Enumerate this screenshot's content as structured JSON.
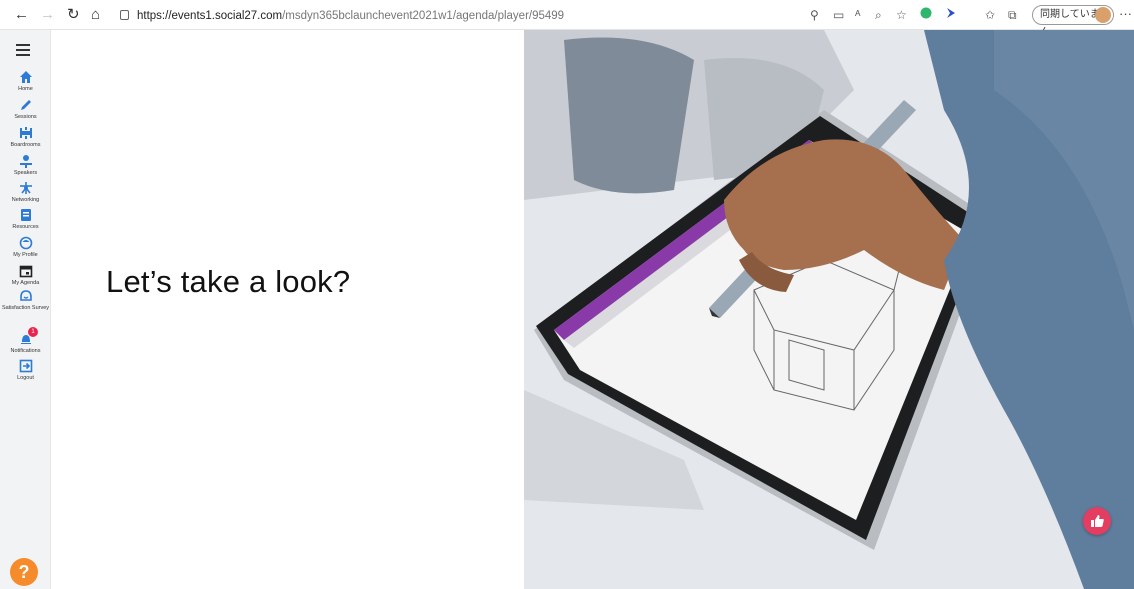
{
  "browser": {
    "url_host": "https://events1.social27.com",
    "url_path": "/msdyn365bclaunchevent2021w1/agenda/player/95499",
    "sync_label": "同期していません"
  },
  "sidebar": {
    "items": [
      {
        "label": "Home",
        "icon": "home-icon"
      },
      {
        "label": "Sessions",
        "icon": "pen-icon"
      },
      {
        "label": "Boardrooms",
        "icon": "boardroom-icon"
      },
      {
        "label": "Speakers",
        "icon": "speakers-icon"
      },
      {
        "label": "Networking",
        "icon": "networking-icon"
      },
      {
        "label": "Resources",
        "icon": "resources-icon"
      },
      {
        "label": "My Profile",
        "icon": "profile-icon"
      },
      {
        "label": "My Agenda",
        "icon": "calendar-icon"
      },
      {
        "label": "Satisfaction Survey",
        "icon": "survey-icon"
      },
      {
        "label": "Notifications",
        "icon": "bell-icon",
        "badge": "1"
      },
      {
        "label": "Logout",
        "icon": "logout-icon"
      }
    ],
    "help_glyph": "?"
  },
  "slide": {
    "title": "Let’s take a look?"
  },
  "colors": {
    "accent": "#2e7bd6",
    "help": "#f68b2b",
    "like": "#e43d62",
    "badge": "#e8254f"
  }
}
